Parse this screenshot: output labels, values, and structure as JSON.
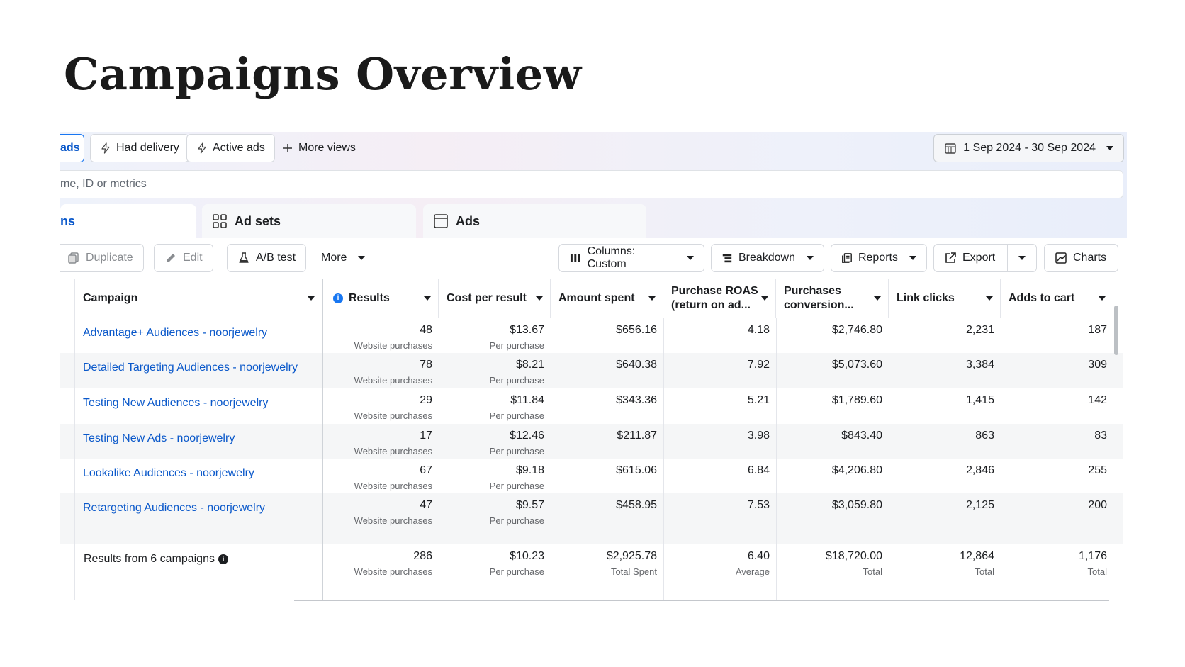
{
  "slide_title": "Campaigns Overview",
  "views": {
    "selected": "ads",
    "had_delivery": "Had delivery",
    "active_ads": "Active ads",
    "more_views": "More views",
    "date_range": "1 Sep 2024 - 30 Sep 2024"
  },
  "search": {
    "placeholder": "me, ID or metrics"
  },
  "tabs": {
    "campaigns": "ns",
    "ad_sets": "Ad sets",
    "ads": "Ads"
  },
  "toolbar": {
    "duplicate": "Duplicate",
    "edit": "Edit",
    "ab_test": "A/B test",
    "more": "More",
    "columns": "Columns: Custom",
    "breakdown": "Breakdown",
    "reports": "Reports",
    "export": "Export",
    "charts": "Charts"
  },
  "table": {
    "headers": {
      "campaign": "Campaign",
      "results": "Results",
      "cost_per_result": "Cost per result",
      "amount_spent": "Amount spent",
      "roas_line1": "Purchase ROAS",
      "roas_line2": "(return on ad...",
      "conv_line1": "Purchases",
      "conv_line2": "conversion...",
      "link_clicks": "Link clicks",
      "adds_to_cart": "Adds to cart"
    },
    "rows": [
      {
        "campaign": "Advantage+ Audiences - noorjewelry",
        "results": "48",
        "results_sub": "Website purchases",
        "cpr": "$13.67",
        "cpr_sub": "Per purchase",
        "spent": "$656.16",
        "roas": "4.18",
        "conv": "$2,746.80",
        "clicks": "2,231",
        "cart": "187"
      },
      {
        "campaign": "Detailed Targeting Audiences - noorjewelry",
        "results": "78",
        "results_sub": "Website purchases",
        "cpr": "$8.21",
        "cpr_sub": "Per purchase",
        "spent": "$640.38",
        "roas": "7.92",
        "conv": "$5,073.60",
        "clicks": "3,384",
        "cart": "309"
      },
      {
        "campaign": "Testing New Audiences - noorjewelry",
        "results": "29",
        "results_sub": "Website purchases",
        "cpr": "$11.84",
        "cpr_sub": "Per purchase",
        "spent": "$343.36",
        "roas": "5.21",
        "conv": "$1,789.60",
        "clicks": "1,415",
        "cart": "142"
      },
      {
        "campaign": "Testing New Ads - noorjewelry",
        "results": "17",
        "results_sub": "Website purchases",
        "cpr": "$12.46",
        "cpr_sub": "Per purchase",
        "spent": "$211.87",
        "roas": "3.98",
        "conv": "$843.40",
        "clicks": "863",
        "cart": "83"
      },
      {
        "campaign": "Lookalike Audiences - noorjewelry",
        "results": "67",
        "results_sub": "Website purchases",
        "cpr": "$9.18",
        "cpr_sub": "Per purchase",
        "spent": "$615.06",
        "roas": "6.84",
        "conv": "$4,206.80",
        "clicks": "2,846",
        "cart": "255"
      },
      {
        "campaign": "Retargeting Audiences - noorjewelry",
        "results": "47",
        "results_sub": "Website purchases",
        "cpr": "$9.57",
        "cpr_sub": "Per purchase",
        "spent": "$458.95",
        "roas": "7.53",
        "conv": "$3,059.80",
        "clicks": "2,125",
        "cart": "200"
      }
    ],
    "totals": {
      "label": "Results from 6 campaigns",
      "results": "286",
      "results_sub": "Website purchases",
      "cpr": "$10.23",
      "cpr_sub": "Per purchase",
      "spent": "$2,925.78",
      "spent_sub": "Total Spent",
      "roas": "6.40",
      "roas_sub": "Average",
      "conv": "$18,720.00",
      "conv_sub": "Total",
      "clicks": "12,864",
      "clicks_sub": "Total",
      "cart": "1,176",
      "cart_sub": "Total"
    }
  },
  "colors": {
    "link_blue": "#0a58ca",
    "accent_blue": "#1877f2",
    "info_blue": "#1877f2"
  }
}
